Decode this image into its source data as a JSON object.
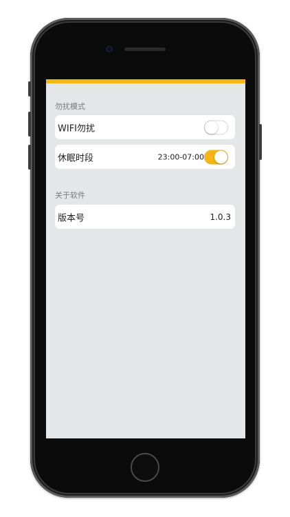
{
  "accent_color": "#f4b515",
  "sections": {
    "dnd": {
      "title": "勿扰模式",
      "wifi": {
        "label": "WIFI勿扰",
        "enabled": false
      },
      "sleep": {
        "label": "休眠时段",
        "time": "23:00-07:00",
        "enabled": true
      }
    },
    "about": {
      "title": "关于软件",
      "version": {
        "label": "版本号",
        "value": "1.0.3"
      }
    }
  },
  "device": {
    "camera_icon": "front-camera-icon",
    "home_icon": "home-button-icon"
  }
}
